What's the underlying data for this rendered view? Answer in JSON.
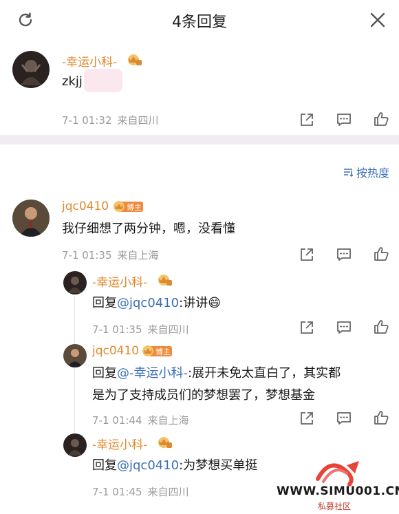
{
  "header": {
    "title": "4条回复",
    "refresh_icon": "refresh-icon",
    "close_icon": "close-icon"
  },
  "sort": {
    "label": "按热度",
    "icon": "sort-icon"
  },
  "top_comment": {
    "username": "-幸运小科-",
    "text": "zkjj",
    "date": "7-1 01:32",
    "source": "来自四川"
  },
  "comments": [
    {
      "username": "jqc0410",
      "badge": "博主",
      "text": "我仔细想了两分钟，嗯，没看懂",
      "date": "7-1 01:35",
      "source": "来自上海"
    }
  ],
  "replies": [
    {
      "username": "-幸运小科-",
      "prefix": "回复",
      "mention": "@jqc0410",
      "text": ":讲讲😄",
      "date": "7-1 01:35",
      "source": "来自四川"
    },
    {
      "username": "jqc0410",
      "badge": "博主",
      "prefix": "回复",
      "mention": "@-幸运小科-",
      "text": ":展开未免太直白了，其实都",
      "text_line2": "是为了支持成员们的梦想罢了，梦想基金",
      "date": "7-1 01:44",
      "source": "来自上海"
    },
    {
      "username": "-幸运小科-",
      "prefix": "回复",
      "mention": "@jqc0410",
      "text": ":为梦想买单挺",
      "date": "7-1 01:45",
      "source": "来自四川"
    }
  ],
  "watermark": {
    "url": "WWW.SIMU001.CN",
    "subtitle": "私募社区"
  },
  "colors": {
    "username": "#e08a2e",
    "mention": "#3a6fb5",
    "meta": "#9a9a9a",
    "divider": "#efedf1"
  }
}
